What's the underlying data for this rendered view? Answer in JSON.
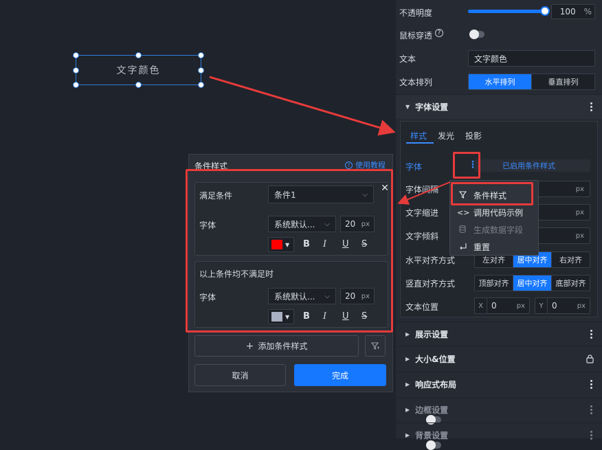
{
  "canvas": {
    "text_box_label": "文字颜色"
  },
  "panel": {
    "opacity": {
      "label": "不透明度",
      "value": "100",
      "unit": "%",
      "level": 1.0
    },
    "mouse_through": {
      "label": "鼠标穿透",
      "icon": "help-circle-icon"
    },
    "text": {
      "label": "文本",
      "value": "文字颜色"
    },
    "text_direction": {
      "label": "文本排列",
      "options": [
        "水平排列",
        "垂直排列"
      ],
      "selected": "水平排列"
    },
    "font_section": {
      "title": "字体设置",
      "tabs": [
        "样式",
        "发光",
        "投影"
      ],
      "active_tab": "样式",
      "font_label": "字体",
      "font_status": "已启用条件样式",
      "letter_spacing_label": "字体间隔",
      "indent_label": "文字缩进",
      "skew_label": "文字倾斜",
      "unit_px": "px",
      "h_align": {
        "label": "水平对齐方式",
        "options": [
          "左对齐",
          "居中对齐",
          "右对齐"
        ],
        "selected": "居中对齐"
      },
      "v_align": {
        "label": "竖直对齐方式",
        "options": [
          "顶部对齐",
          "居中对齐",
          "底部对齐"
        ],
        "selected": "居中对齐"
      },
      "position": {
        "label": "文本位置",
        "x_label": "X",
        "x_value": "0",
        "y_label": "Y",
        "y_value": "0"
      }
    },
    "sections": [
      {
        "title": "展示设置",
        "icon": "more-icon"
      },
      {
        "title": "大小&位置",
        "icon": "lock-icon"
      },
      {
        "title": "响应式布局",
        "icon": "more-icon"
      },
      {
        "title": "边框设置",
        "icon": "toggle"
      },
      {
        "title": "背景设置",
        "icon": "toggle"
      }
    ]
  },
  "context_menu": {
    "items": [
      {
        "label": "条件样式",
        "icon": "filter-icon",
        "enabled": true
      },
      {
        "label": "调用代码示例",
        "icon": "code-icon",
        "enabled": true
      },
      {
        "label": "生成数据字段",
        "icon": "database-icon",
        "enabled": false
      },
      {
        "label": "重置",
        "icon": "reset-icon",
        "enabled": true
      }
    ]
  },
  "condition_dialog": {
    "title": "条件样式",
    "help_link": "使用教程",
    "rule1": {
      "cond_label": "满足条件",
      "cond_value": "条件1",
      "font_label": "字体",
      "font_family": "系统默认...",
      "font_size": "20",
      "unit": "px",
      "color": "#ff0000"
    },
    "fallback": {
      "title": "以上条件均不满足时",
      "font_label": "字体",
      "font_family": "系统默认...",
      "font_size": "20",
      "unit": "px",
      "color": "#a9b0c3"
    },
    "format_buttons": [
      "B",
      "I",
      "U",
      "S"
    ],
    "add_label": "添加条件样式",
    "cancel_label": "取消",
    "done_label": "完成"
  },
  "colors": {
    "accent": "#1677ff",
    "highlight": "#e63b3b"
  }
}
